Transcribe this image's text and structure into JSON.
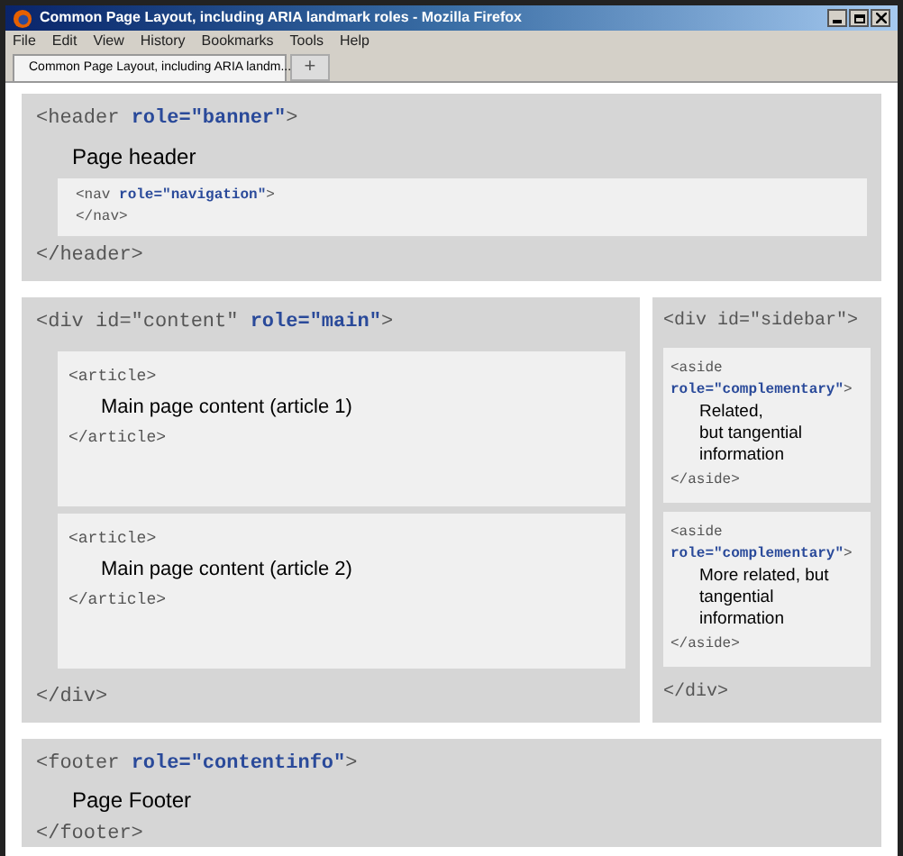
{
  "window": {
    "title": "Common Page Layout, including ARIA landmark roles - Mozilla Firefox"
  },
  "menu": [
    "File",
    "Edit",
    "View",
    "History",
    "Bookmarks",
    "Tools",
    "Help"
  ],
  "tabs": [
    {
      "label": "Common Page Layout, including ARIA landm...",
      "selected": true
    }
  ],
  "new_tab": "+",
  "header": {
    "open": {
      "text": "<header ",
      "attr": "role=\"banner\"",
      "end": ">"
    },
    "content": "Page header",
    "nav": {
      "open": {
        "text": "<nav ",
        "attr": "role=\"navigation\"",
        "end": ">"
      },
      "close": "</nav>"
    },
    "close": "</header>"
  },
  "main": {
    "open": {
      "text": "<div id=\"content\" ",
      "attr": "role=\"main\"",
      "end": ">"
    },
    "articles": [
      {
        "open": "<article>",
        "content": "Main page content (article 1)",
        "close": "</article>"
      },
      {
        "open": "<article>",
        "content": "Main page content (article 2)",
        "close": "</article>"
      }
    ],
    "close": "</div>"
  },
  "sidebar": {
    "open": "<div id=\"sidebar\">",
    "asides": [
      {
        "open_line_1": "<aside",
        "open_line_2": {
          "attr": "role=\"complementary\"",
          "end": ">"
        },
        "content": "Related,\nbut tangential\ninformation",
        "close": "</aside>"
      },
      {
        "open_line_1": "<aside",
        "open_line_2": {
          "attr": "role=\"complementary\"",
          "end": ">"
        },
        "content": "More related, but\ntangential\ninformation",
        "close": "</aside>"
      }
    ],
    "close": "</div>"
  },
  "footer": {
    "open": {
      "text": "<footer ",
      "attr": "role=\"contentinfo\"",
      "end": ">"
    },
    "content": "Page Footer",
    "close": "</footer>"
  }
}
